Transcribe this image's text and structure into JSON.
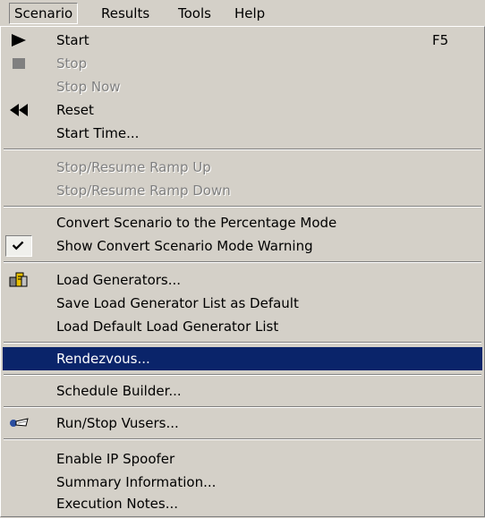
{
  "menubar": {
    "items": [
      {
        "label": "Scenario"
      },
      {
        "label": "Results"
      },
      {
        "label": "Tools"
      },
      {
        "label": "Help"
      }
    ]
  },
  "menu": {
    "start": {
      "label": "Start",
      "shortcut": "F5"
    },
    "stop": {
      "label": "Stop"
    },
    "stop_now": {
      "label": "Stop Now"
    },
    "reset": {
      "label": "Reset"
    },
    "start_time": {
      "label": "Start Time..."
    },
    "stop_resume_ramp_up": {
      "label": "Stop/Resume Ramp Up"
    },
    "stop_resume_ramp_down": {
      "label": "Stop/Resume Ramp Down"
    },
    "convert_percentage": {
      "label": "Convert Scenario to the Percentage Mode"
    },
    "show_convert_warning": {
      "label": "Show Convert Scenario Mode Warning",
      "checked": true
    },
    "load_generators": {
      "label": "Load Generators..."
    },
    "save_lg_list": {
      "label": "Save Load Generator List as Default"
    },
    "load_default_lg_list": {
      "label": "Load Default Load Generator List"
    },
    "rendezvous": {
      "label": "Rendezvous..."
    },
    "schedule_builder": {
      "label": "Schedule Builder..."
    },
    "run_stop_vusers": {
      "label": "Run/Stop Vusers..."
    },
    "enable_ip_spoofer": {
      "label": "Enable IP Spoofer"
    },
    "summary_information": {
      "label": "Summary Information..."
    },
    "execution_notes": {
      "label": "Execution Notes..."
    }
  },
  "colors": {
    "menu_bg": "#d4d0c8",
    "highlight_bg": "#0a246a",
    "disabled_text": "#808080"
  }
}
